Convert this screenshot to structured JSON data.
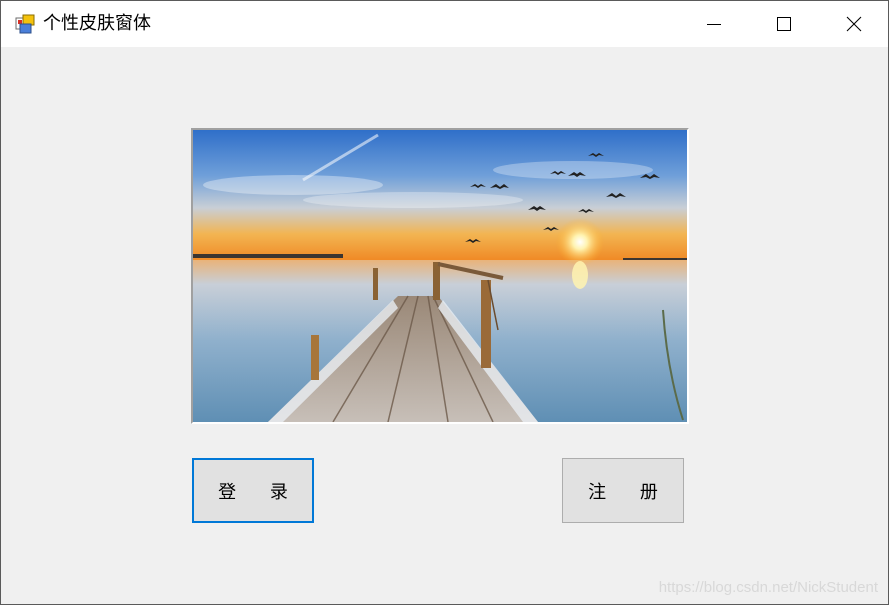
{
  "window": {
    "title": "个性皮肤窗体",
    "app_icon": "winforms-app-icon",
    "controls": {
      "minimize_icon": "minimize-icon",
      "maximize_icon": "maximize-icon",
      "close_icon": "close-icon"
    }
  },
  "picture": {
    "description_icon": "sunset-pier-image"
  },
  "buttons": {
    "login_label": "登 录",
    "register_label": "注 册"
  },
  "watermark": "https://blog.csdn.net/NickStudent",
  "colors": {
    "focus_border": "#0078d7",
    "button_bg": "#e1e1e1",
    "client_bg": "#f0f0f0"
  }
}
